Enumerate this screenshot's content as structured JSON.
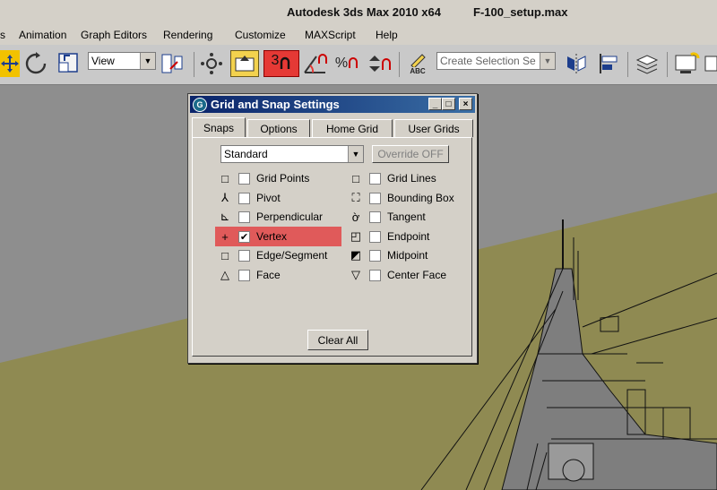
{
  "window": {
    "app_title": "Autodesk 3ds Max  2010 x64",
    "file_name": "F-100_setup.max"
  },
  "menu": {
    "items": [
      {
        "label": "s"
      },
      {
        "label": "Animation"
      },
      {
        "label": "Graph Editors"
      },
      {
        "label": "Rendering"
      },
      {
        "label": "Customize"
      },
      {
        "label": "MAXScript"
      },
      {
        "label": "Help"
      }
    ]
  },
  "toolbar": {
    "view_select": "View",
    "snap_toggle_label": "3",
    "percent_label": "%",
    "abc_label": "ABC",
    "selection_set_placeholder": "Create Selection Se",
    "highlight_color": "#e53935"
  },
  "dialog": {
    "title": "Grid and Snap Settings",
    "tabs": [
      {
        "label": "Snaps"
      },
      {
        "label": "Options"
      },
      {
        "label": "Home Grid"
      },
      {
        "label": "User Grids"
      }
    ],
    "preset_select": "Standard",
    "override_label": "Override OFF",
    "snaps_left": [
      {
        "label": "Grid Points",
        "checked": false,
        "symbol": "□"
      },
      {
        "label": "Pivot",
        "checked": false,
        "symbol": "⅄"
      },
      {
        "label": "Perpendicular",
        "checked": false,
        "symbol": "⊾"
      },
      {
        "label": "Vertex",
        "checked": true,
        "symbol": "+"
      },
      {
        "label": "Edge/Segment",
        "checked": false,
        "symbol": "□"
      },
      {
        "label": "Face",
        "checked": false,
        "symbol": "△"
      }
    ],
    "snaps_right": [
      {
        "label": "Grid Lines",
        "checked": false,
        "symbol": "□"
      },
      {
        "label": "Bounding Box",
        "checked": false,
        "symbol": "⛶"
      },
      {
        "label": "Tangent",
        "checked": false,
        "symbol": "ờ"
      },
      {
        "label": "Endpoint",
        "checked": false,
        "symbol": "◰"
      },
      {
        "label": "Midpoint",
        "checked": false,
        "symbol": "◩"
      },
      {
        "label": "Center Face",
        "checked": false,
        "symbol": "▽"
      }
    ],
    "clear_all_label": "Clear All",
    "highlight_color": "#e05a5a"
  },
  "viewport": {
    "background_color": "#8e8e8e",
    "ground_color": "#8f8a52"
  }
}
